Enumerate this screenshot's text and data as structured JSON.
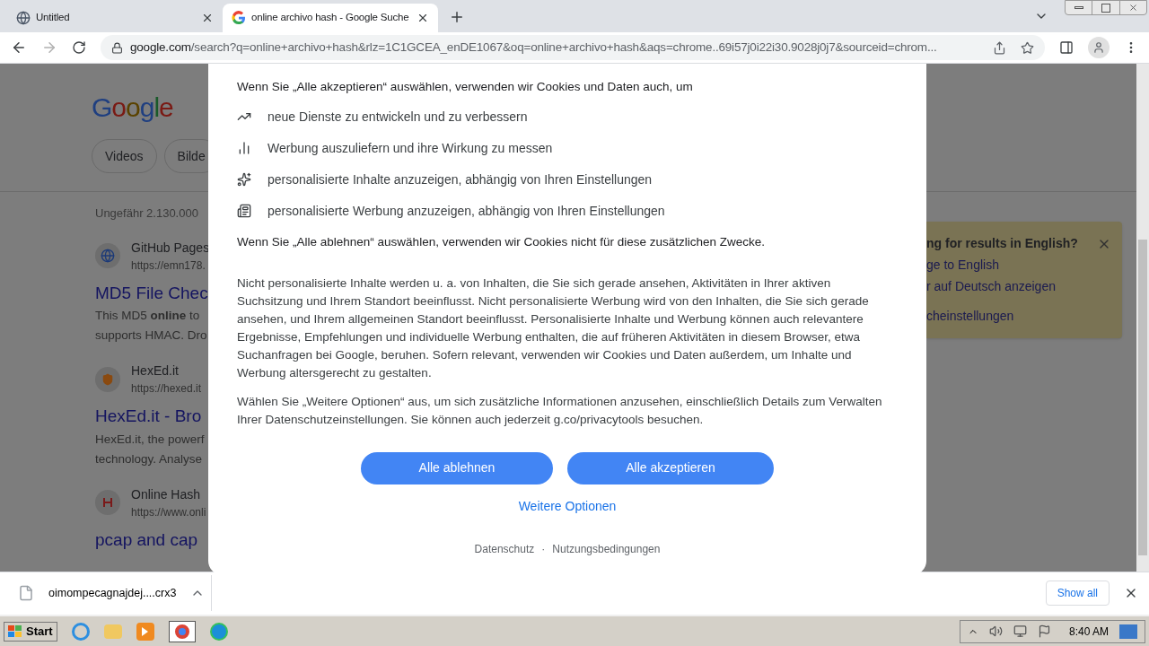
{
  "browser": {
    "tabs": [
      {
        "title": "Untitled",
        "selected": false,
        "kind": "globe"
      },
      {
        "title": "online archivo hash - Google Suche",
        "selected": true,
        "kind": "google"
      }
    ],
    "url_host": "google.com",
    "url_path": "/search?q=online+archivo+hash&rlz=1C1GCEA_enDE1067&oq=online+archivo+hash&aqs=chrome..69i57j0i22i30.9028j0j7&sourceid=chrom..."
  },
  "page": {
    "logo": "Google",
    "chips": [
      "Videos",
      "Bilde"
    ],
    "result_count": "Ungefähr 2.130.000",
    "results": [
      {
        "kind": "globe",
        "site": "GitHub Pages",
        "url": "https://emn178.",
        "title": "MD5 File Chec",
        "snippet": [
          "This MD5 **online** to",
          "supports HMAC. Dro"
        ]
      },
      {
        "kind": "shield",
        "site": "HexEd.it",
        "url": "https://hexed.it",
        "title": "HexEd.it - Bro",
        "snippet": [
          "HexEd.it, the powerf",
          "technology. Analyse"
        ]
      },
      {
        "kind": "letter",
        "site": "Online Hash",
        "url": "https://www.onli",
        "title": "pcap and cap"
      }
    ],
    "language_card": {
      "title": "ng for results in English?",
      "links": [
        "ge to English",
        "r auf Deutsch anzeigen",
        "cheinstellungen"
      ]
    }
  },
  "consent": {
    "intro": "Wenn Sie „Alle akzeptieren“ auswählen, verwenden wir Cookies und Daten auch, um",
    "bullets": [
      {
        "kind": "trend",
        "text": "neue Dienste zu entwickeln und zu verbessern"
      },
      {
        "kind": "bars",
        "text": "Werbung auszuliefern und ihre Wirkung zu messen"
      },
      {
        "kind": "sparkle",
        "text": "personalisierte Inhalte anzuzeigen, abhängig von Ihren Einstellungen"
      },
      {
        "kind": "ad",
        "text": "personalisierte Werbung anzuzeigen, abhängig von Ihren Einstellungen"
      }
    ],
    "reject_note": "Wenn Sie „Alle ablehnen“ auswählen, verwenden wir Cookies nicht für diese zusätzlichen Zwecke.",
    "paragraphs": [
      "Nicht personalisierte Inhalte werden u. a. von Inhalten, die Sie sich gerade ansehen, Aktivitäten in Ihrer aktiven Suchsitzung und Ihrem Standort beeinflusst. Nicht personalisierte Werbung wird von den Inhalten, die Sie sich gerade ansehen, und Ihrem allgemeinen Standort beeinflusst. Personalisierte Inhalte und Werbung können auch relevantere Ergebnisse, Empfehlungen und individuelle Werbung enthalten, die auf früheren Aktivitäten in diesem Browser, etwa Suchanfragen bei Google, beruhen. Sofern relevant, verwenden wir Cookies und Daten außerdem, um Inhalte und Werbung altersgerecht zu gestalten.",
      "Wählen Sie „Weitere Optionen“ aus, um sich zusätzliche Informationen anzusehen, einschließlich Details zum Verwalten Ihrer Datenschutzeinstellungen. Sie können auch jederzeit g.co/privacytools besuchen."
    ],
    "buttons": [
      "Alle ablehnen",
      "Alle akzeptieren"
    ],
    "more_options": "Weitere Optionen",
    "footer_links": [
      "Datenschutz",
      "Nutzungsbedingungen"
    ],
    "footer_separator": "·"
  },
  "downloads": {
    "file": "oimompecagnajdej....crx3",
    "show_all": "Show all"
  },
  "taskbar": {
    "start": "Start",
    "clock": "8:40 AM"
  }
}
